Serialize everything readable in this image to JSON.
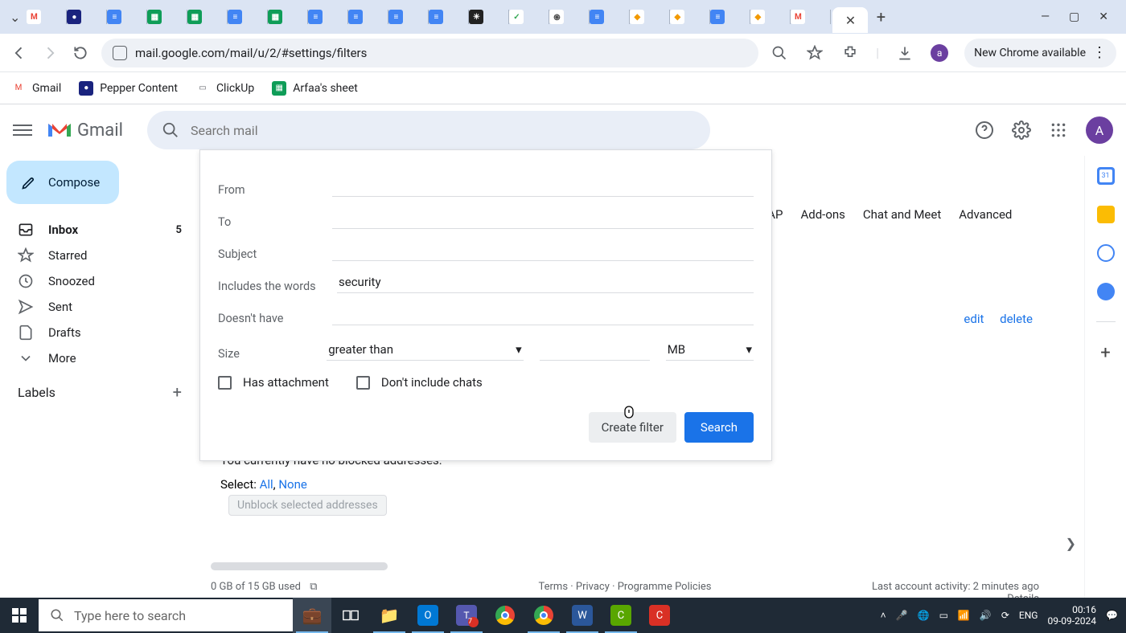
{
  "browser": {
    "url": "mail.google.com/mail/u/2/#settings/filters",
    "new_chrome": "New Chrome available",
    "tabs_icons": [
      {
        "bg": "#fff",
        "txt": "M",
        "col": "#ea4335"
      },
      {
        "bg": "#1a237e",
        "txt": "●",
        "col": "#fff"
      },
      {
        "bg": "#4285f4",
        "txt": "≡",
        "col": "#fff"
      },
      {
        "bg": "#0f9d58",
        "txt": "▦",
        "col": "#fff"
      },
      {
        "bg": "#0f9d58",
        "txt": "▦",
        "col": "#fff"
      },
      {
        "bg": "#4285f4",
        "txt": "≡",
        "col": "#fff"
      },
      {
        "bg": "#0f9d58",
        "txt": "▦",
        "col": "#fff"
      },
      {
        "bg": "#4285f4",
        "txt": "≡",
        "col": "#fff"
      },
      {
        "bg": "#4285f4",
        "txt": "≡",
        "col": "#fff"
      },
      {
        "bg": "#4285f4",
        "txt": "≡",
        "col": "#fff"
      },
      {
        "bg": "#4285f4",
        "txt": "≡",
        "col": "#fff"
      },
      {
        "bg": "#222",
        "txt": "✳",
        "col": "#fff"
      },
      {
        "bg": "#fff",
        "txt": "✓",
        "col": "#34a853"
      },
      {
        "bg": "#fff",
        "txt": "֍",
        "col": "#444"
      },
      {
        "bg": "#4285f4",
        "txt": "≡",
        "col": "#fff"
      },
      {
        "bg": "#fff",
        "txt": "◆",
        "col": "#f29900"
      },
      {
        "bg": "#fff",
        "txt": "◆",
        "col": "#f29900"
      },
      {
        "bg": "#4285f4",
        "txt": "≡",
        "col": "#fff"
      },
      {
        "bg": "#fff",
        "txt": "◆",
        "col": "#f29900"
      },
      {
        "bg": "#fff",
        "txt": "M",
        "col": "#ea4335"
      }
    ]
  },
  "bookmarks": [
    {
      "label": "Gmail",
      "bg": "#fff",
      "txt": "M",
      "col": "#ea4335"
    },
    {
      "label": "Pepper Content",
      "bg": "#1a237e",
      "txt": "●",
      "col": "#fff"
    },
    {
      "label": "ClickUp",
      "bg": "transparent",
      "txt": "▭",
      "col": "#5f6368"
    },
    {
      "label": "Arfaa's sheet",
      "bg": "#0f9d58",
      "txt": "▦",
      "col": "#fff"
    }
  ],
  "gmail": {
    "name": "Gmail",
    "search_placeholder": "Search mail",
    "compose": "Compose",
    "sidebar": [
      {
        "label": "Inbox",
        "count": "5",
        "icon": "inbox",
        "active": true
      },
      {
        "label": "Starred",
        "icon": "star"
      },
      {
        "label": "Snoozed",
        "icon": "clock"
      },
      {
        "label": "Sent",
        "icon": "send"
      },
      {
        "label": "Drafts",
        "icon": "file"
      },
      {
        "label": "More",
        "icon": "chev"
      }
    ],
    "labels_heading": "Labels",
    "settings_tabs_tail": [
      "IAP",
      "Add-ons",
      "Chat and Meet",
      "Advanced"
    ],
    "edit": "edit",
    "delete": "delete",
    "blocked_msg": "You currently have no blocked addresses.",
    "select_prefix": "Select: ",
    "select_all": "All",
    "select_none": "None",
    "unblock_btn": "Unblock selected addresses",
    "footer_storage": "0 GB of 15 GB used",
    "footer_links": "Terms · Privacy · Programme Policies",
    "footer_activity": "Last account activity: 2 minutes ago",
    "footer_details": "Details",
    "avatar_letter": "A"
  },
  "filter": {
    "from": "From",
    "to": "To",
    "subject": "Subject",
    "includes": "Includes the words",
    "includes_value": "security",
    "doesnt": "Doesn't have",
    "size": "Size",
    "size_op": "greater than",
    "size_unit": "MB",
    "has_attachment": "Has attachment",
    "no_chats": "Don't include chats",
    "create": "Create filter",
    "search": "Search"
  },
  "taskbar": {
    "search_placeholder": "Type here to search",
    "lang": "ENG",
    "time": "00:16",
    "date": "09-09-2024"
  }
}
